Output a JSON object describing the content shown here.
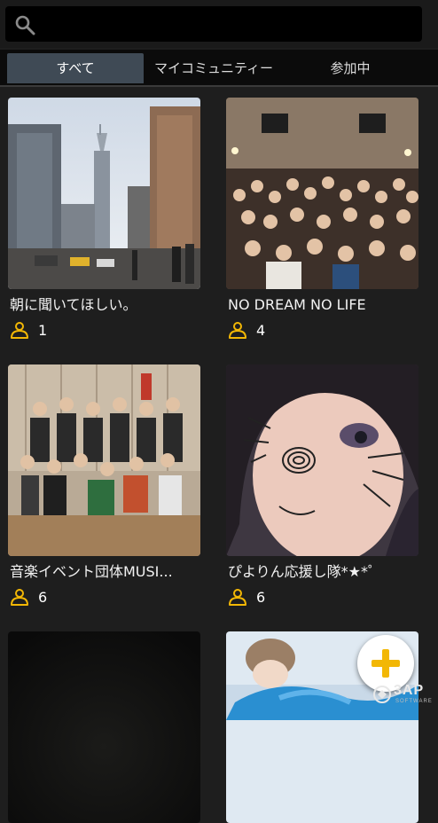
{
  "search": {
    "placeholder": "",
    "value": ""
  },
  "tabs": [
    {
      "label": "すべて",
      "active": true
    },
    {
      "label": "マイコミュニティー",
      "active": false
    },
    {
      "label": "参加中",
      "active": false
    }
  ],
  "communities": [
    {
      "name": "朝に聞いてほしい。",
      "members": "1",
      "image": "city-skyline-photo"
    },
    {
      "name": "NO DREAM NO LIFE",
      "members": "4",
      "image": "crowd-group-photo"
    },
    {
      "name": "音楽イベント団体MUSI...",
      "members": "6",
      "image": "band-group-photo"
    },
    {
      "name": "ぴよりん応援し隊*★*゜",
      "members": "6",
      "image": "selfie-photo"
    },
    {
      "name": "",
      "members": "",
      "image": "dark-photo"
    },
    {
      "name": "",
      "members": "",
      "image": "snow-portrait-photo"
    }
  ],
  "fab": {
    "icon": "plus-icon"
  },
  "watermark": {
    "text": "3AP",
    "sub": "SOFTWARE"
  },
  "colors": {
    "accent": "#f2b705",
    "tab_active": "#3f4a55",
    "background": "#1e1e1e"
  }
}
